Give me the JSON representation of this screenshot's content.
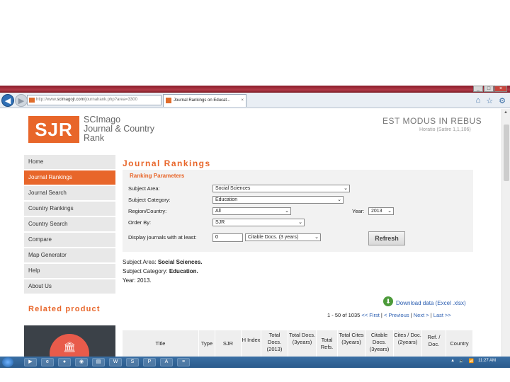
{
  "browser": {
    "address_prefix": "http://www.",
    "address_domain": "scimagojr.com",
    "address_path": "/journalrank.php?area=3300",
    "tab_title": "Journal Rankings on Educat...",
    "tab_close": "×"
  },
  "header": {
    "logo": "SJR",
    "logo_line1": "SCImago",
    "logo_line2": "Journal & Country",
    "logo_line3": "Rank",
    "motto": "EST MODUS IN REBUS",
    "server": "Horatio (Satire 1,1,106)"
  },
  "menu": {
    "items": [
      {
        "label": "Home"
      },
      {
        "label": "Journal Rankings"
      },
      {
        "label": "Journal Search"
      },
      {
        "label": "Country Rankings"
      },
      {
        "label": "Country Search"
      },
      {
        "label": "Compare"
      },
      {
        "label": "Map Generator"
      },
      {
        "label": "Help"
      },
      {
        "label": "About Us"
      }
    ],
    "related_product": "Related product"
  },
  "main": {
    "heading": "Journal Rankings",
    "params_title": "Ranking Parameters",
    "subject_area_label": "Subject Area:",
    "subject_area_value": "Social Sciences",
    "subject_category_label": "Subject Category:",
    "subject_category_value": "Education",
    "region_label": "Region/Country:",
    "region_value": "All",
    "year_label": "Year:",
    "year_value": "2013",
    "order_label": "Order By:",
    "order_value": "SJR",
    "display_label": "Display journals with at least:",
    "display_value": "0",
    "display_type": "Citable Docs. (3 years)",
    "refresh": "Refresh",
    "summary_area_label": "Subject Area:",
    "summary_area_value": "Social Sciences.",
    "summary_cat_label": "Subject Category:",
    "summary_cat_value": "Education.",
    "summary_year": "Year: 2013.",
    "download": "Download data (Excel .xlsx)",
    "pager_count": "1 - 50 of 1035",
    "pager_first": "<< First",
    "pager_prev": "< Previous",
    "pager_next": "Next >",
    "pager_last": "Last >>",
    "sep": "|"
  },
  "table": {
    "headers": [
      "Title",
      "Type",
      "SJR",
      "H Index",
      "Total Docs. (2013)",
      "Total Docs. (3years)",
      "Total Refs.",
      "Total Cites (3years)",
      "Citable Docs. (3years)",
      "Cites / Doc. (2years)",
      "Ref. / Doc.",
      "Country"
    ]
  },
  "taskbar": {
    "time": "11:27 AM"
  }
}
